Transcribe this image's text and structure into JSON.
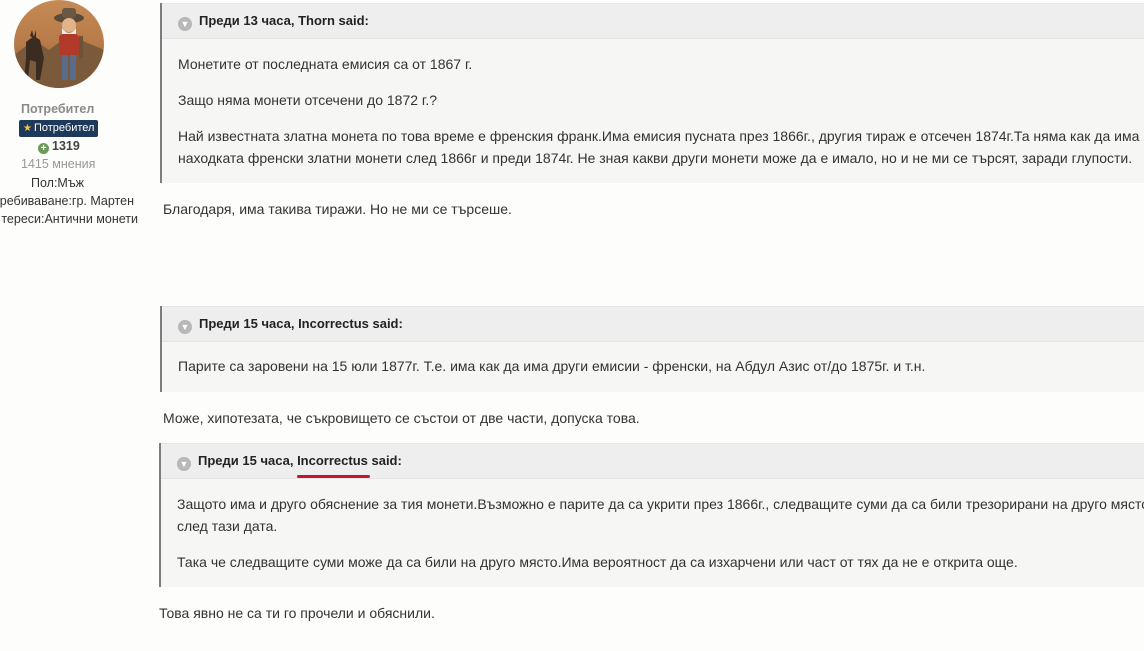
{
  "sidebar": {
    "username": "Потребител",
    "rank": "Потребител",
    "reputation": "1319",
    "posts": "1415 мнения",
    "gender": "Пол:Мъж",
    "location": "ребиваване:гр. Мартен",
    "interests": "тереси:Антични монети"
  },
  "posts": [
    {
      "quote": {
        "time": "Преди 13 часа, ",
        "author": "Thorn",
        "said": " said:",
        "paragraphs": [
          "Монетите от последната емисия са от  1867 г.",
          "Защо няма монети отсечени до 1872 г.?",
          "Най известната златна монета по това време е френския франк.Има емисия пусната през 1866г., другия тираж е отсечен 1874г.Та няма как да има в",
          "находката френски златни монети след 1866г и преди 1874г.  Не зная какви други монети може да е имало, но и не ми се търсят, заради глупости."
        ]
      },
      "reply": "Благодаря, има такива тиражи. Но не ми се търсеше."
    },
    {
      "quote": {
        "time": "Преди 15 часа, ",
        "author": "Incorrectus",
        "said": " said:",
        "paragraphs": [
          "Парите са заровени на 15 юли 1877г. Т.е. има как да има други емисии - френски, на Абдул Азис от/до 1875г. и т.н."
        ]
      },
      "reply": "Може, хипотезата, че съкровището се състои от две части, допуска това."
    },
    {
      "quote": {
        "time": "Преди 15 часа, ",
        "author": "Incorrectus",
        "said": " said:",
        "paragraphs": [
          "Защото има и друго обяснение за тия монети.Възможно е парите да са укрити през 1866г., следващите суми да са били трезорирани на друго място",
          "след тази дата.",
          "Така че следващите суми може да са били на друго място.Има вероятност да са изхарчени или част от тях да не е открита още."
        ]
      },
      "reply": "Това явно не са ти го прочели и обяснили."
    }
  ],
  "colors": {
    "quote_border": "#7d7d7d",
    "quote_header_bg": "#eeeeee",
    "quote_body_bg": "#f6f6f4",
    "rank_badge_bg": "#1e3a5a",
    "reputation_green": "#6c9a5b",
    "annotation_underline": "#c4162a"
  },
  "icons": {
    "quote_toggle": "chevron-down-icon",
    "reputation": "plus-circle-icon",
    "rank": "star-icon"
  }
}
